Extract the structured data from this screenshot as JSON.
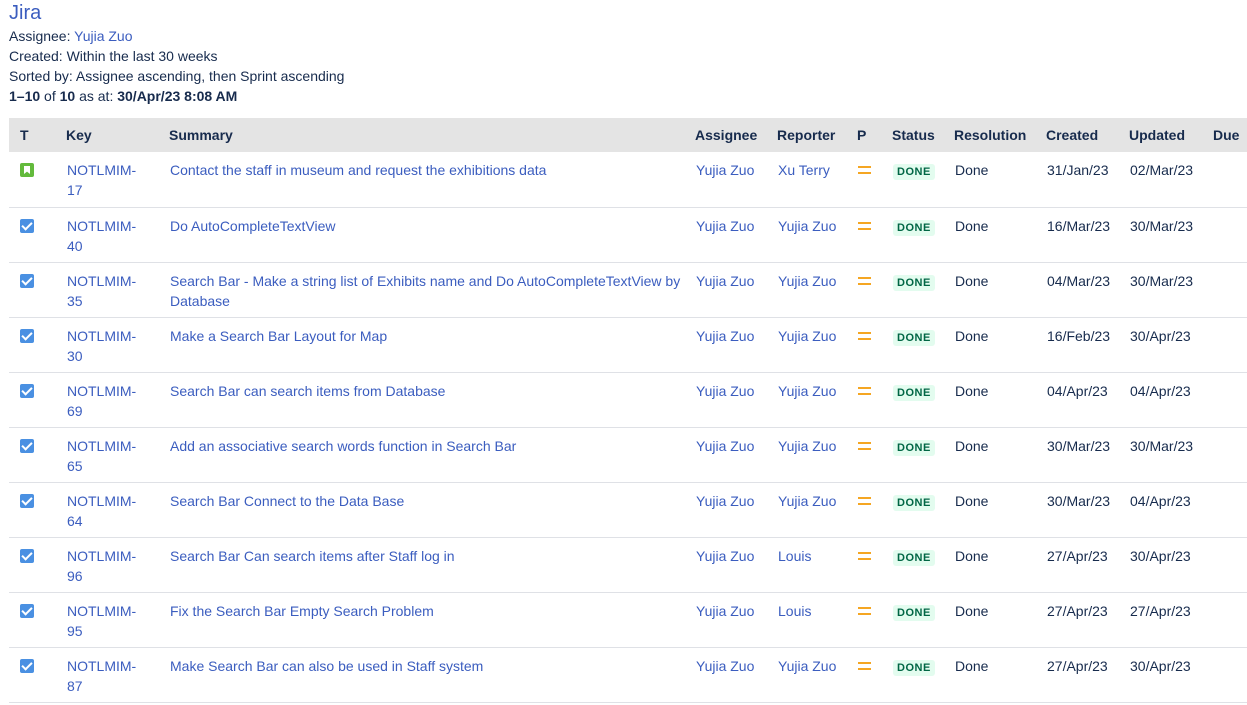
{
  "header": {
    "title": "Jira",
    "assignee_label": "Assignee: ",
    "assignee_value": "Yujia Zuo",
    "created_line": "Created: Within the last 30 weeks",
    "sorted_line": "Sorted by: Assignee ascending, then Sprint ascending",
    "range": "1–10",
    "of": " of ",
    "total": "10",
    "as_at": " as at: ",
    "timestamp": "30/Apr/23 8:08 AM"
  },
  "columns": [
    "T",
    "Key",
    "Summary",
    "Assignee",
    "Reporter",
    "P",
    "Status",
    "Resolution",
    "Created",
    "Updated",
    "Due"
  ],
  "rows": [
    {
      "type": "story",
      "key1": "NOTLMIM-",
      "key2": "17",
      "summary": "Contact the staff in museum and request the exhibitions data",
      "assignee": "Yujia Zuo",
      "reporter": "Xu Terry",
      "status": "DONE",
      "resolution": "Done",
      "created": "31/Jan/23",
      "updated": "02/Mar/23"
    },
    {
      "type": "task",
      "key1": "NOTLMIM-",
      "key2": "40",
      "summary": "Do AutoCompleteTextView",
      "assignee": "Yujia Zuo",
      "reporter": "Yujia Zuo",
      "status": "DONE",
      "resolution": "Done",
      "created": "16/Mar/23",
      "updated": "30/Mar/23"
    },
    {
      "type": "task",
      "key1": "NOTLMIM-",
      "key2": "35",
      "summary": "Search Bar - Make a string list of Exhibits name and Do AutoCompleteTextView by Database",
      "assignee": "Yujia Zuo",
      "reporter": "Yujia Zuo",
      "status": "DONE",
      "resolution": "Done",
      "created": "04/Mar/23",
      "updated": "30/Mar/23"
    },
    {
      "type": "task",
      "key1": "NOTLMIM-",
      "key2": "30",
      "summary": "Make a Search Bar Layout for Map",
      "assignee": "Yujia Zuo",
      "reporter": "Yujia Zuo",
      "status": "DONE",
      "resolution": "Done",
      "created": "16/Feb/23",
      "updated": "30/Apr/23"
    },
    {
      "type": "task",
      "key1": "NOTLMIM-",
      "key2": "69",
      "summary": "Search Bar can search items from Database",
      "assignee": "Yujia Zuo",
      "reporter": "Yujia Zuo",
      "status": "DONE",
      "resolution": "Done",
      "created": "04/Apr/23",
      "updated": "04/Apr/23"
    },
    {
      "type": "task",
      "key1": "NOTLMIM-",
      "key2": "65",
      "summary": "Add an associative search words function in Search Bar",
      "assignee": "Yujia Zuo",
      "reporter": "Yujia Zuo",
      "status": "DONE",
      "resolution": "Done",
      "created": "30/Mar/23",
      "updated": "30/Mar/23"
    },
    {
      "type": "task",
      "key1": "NOTLMIM-",
      "key2": "64",
      "summary": "Search Bar Connect to the Data Base",
      "assignee": "Yujia Zuo",
      "reporter": "Yujia Zuo",
      "status": "DONE",
      "resolution": "Done",
      "created": "30/Mar/23",
      "updated": "04/Apr/23"
    },
    {
      "type": "task",
      "key1": "NOTLMIM-",
      "key2": "96",
      "summary": "Search Bar Can search items after Staff log in",
      "assignee": "Yujia Zuo",
      "reporter": "Louis",
      "status": "DONE",
      "resolution": "Done",
      "created": "27/Apr/23",
      "updated": "30/Apr/23"
    },
    {
      "type": "task",
      "key1": "NOTLMIM-",
      "key2": "95",
      "summary": "Fix the Search Bar Empty Search Problem",
      "assignee": "Yujia Zuo",
      "reporter": "Louis",
      "status": "DONE",
      "resolution": "Done",
      "created": "27/Apr/23",
      "updated": "27/Apr/23"
    },
    {
      "type": "task",
      "key1": "NOTLMIM-",
      "key2": "87",
      "summary": "Make Search Bar can also be used in Staff system",
      "assignee": "Yujia Zuo",
      "reporter": "Yujia Zuo",
      "status": "DONE",
      "resolution": "Done",
      "created": "27/Apr/23",
      "updated": "30/Apr/23"
    }
  ],
  "icons": {
    "story": "story-icon",
    "task": "task-checkbox-icon",
    "priority": "medium-priority-icon"
  },
  "colors": {
    "link": "#3b5dbf",
    "header_bg": "#e4e4e4",
    "done_bg": "#e3fcef",
    "done_text": "#006644",
    "story": "#63ba3c",
    "task": "#4a90e2",
    "priority": "#f5a623"
  }
}
